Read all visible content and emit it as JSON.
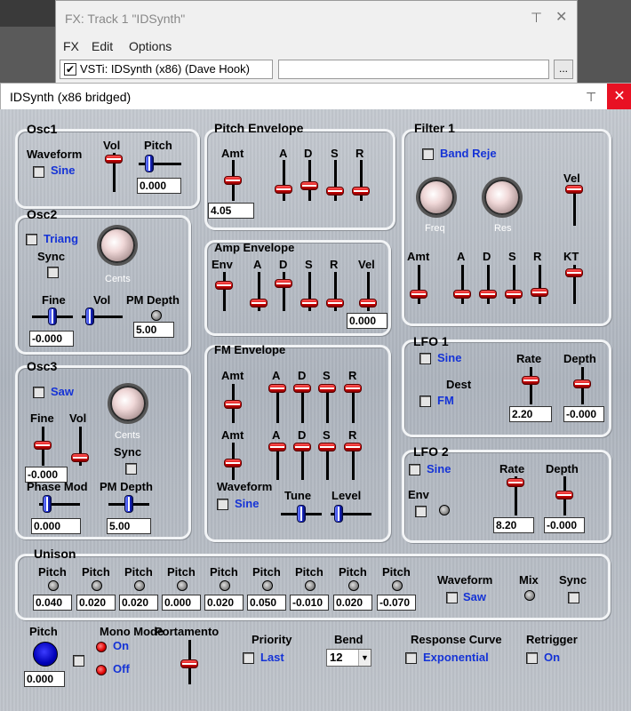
{
  "fx_window": {
    "title": "FX: Track 1 \"IDSynth\"",
    "menu": [
      "FX",
      "Edit",
      "Options"
    ],
    "plugin_checked": "✔",
    "plugin_label": "VSTi: IDSynth (x86) (Dave Hook)",
    "browse": "...",
    "pin": "⊤",
    "close": "✕"
  },
  "window": {
    "title": "IDSynth (x86 bridged)",
    "pin": "⊤",
    "close": "✕"
  },
  "osc1": {
    "title": "Osc1",
    "waveform_label": "Waveform",
    "waveform": "Sine",
    "vol_label": "Vol",
    "pitch_label": "Pitch",
    "pitch_value": "0.000",
    "vol": 0.9,
    "pitch": 0.15
  },
  "osc2": {
    "title": "Osc2",
    "waveform": "Triang",
    "sync_label": "Sync",
    "cents_label": "Cents",
    "fine_label": "Fine",
    "vol_label": "Vol",
    "pm_depth_label": "PM Depth",
    "fine_value": "-0.000",
    "pm_depth_value": "5.00",
    "fine": 0.5,
    "vol": 0.1
  },
  "osc3": {
    "title": "Osc3",
    "waveform": "Saw",
    "cents_label": "Cents",
    "fine_label": "Fine",
    "vol_label": "Vol",
    "sync_label": "Sync",
    "fine_value": "-0.000",
    "phase_mod_label": "Phase Mod",
    "pm_depth_label": "PM Depth",
    "phase_mod_value": "0.000",
    "pm_depth_value": "5.00",
    "fine": 0.5,
    "vol": 0.1,
    "phase_mod": 0.1,
    "pm_depth": 0.5
  },
  "pitch_env": {
    "title": "Pitch Envelope",
    "amt_label": "Amt",
    "a": "A",
    "d": "D",
    "s": "S",
    "r": "R",
    "amt_value": "4.05",
    "amt": 0.4,
    "a_v": 0.2,
    "d_v": 0.3,
    "s_v": 0.0,
    "r_v": 0.0
  },
  "amp_env": {
    "title": "Amp Envelope",
    "env_label": "Env",
    "a": "A",
    "d": "D",
    "s": "S",
    "r": "R",
    "vel_label": "Vel",
    "vel_value": "0.000",
    "env": 0.9,
    "a_v": 0.1,
    "d_v": 0.85,
    "s_v": 0.0,
    "r_v": 0.0,
    "vel": 0.0
  },
  "fm_env": {
    "title": "FM Envelope",
    "amt_label": "Amt",
    "a": "A",
    "d": "D",
    "s": "S",
    "r": "R",
    "amt2_label": "Amt",
    "waveform_label": "Waveform",
    "waveform": "Sine",
    "tune_label": "Tune",
    "level_label": "Level",
    "tune": 0.5,
    "level": 0.1
  },
  "filter1": {
    "title": "Filter 1",
    "type": "Band Reje",
    "freq_label": "Freq",
    "res_label": "Res",
    "vel_label": "Vel",
    "amt_label": "Amt",
    "a": "A",
    "d": "D",
    "s": "S",
    "r": "R",
    "kt_label": "KT"
  },
  "lfo1": {
    "title": "LFO 1",
    "waveform": "Sine",
    "dest_label": "Dest",
    "dest": "FM",
    "rate_label": "Rate",
    "depth_label": "Depth",
    "rate_value": "2.20",
    "depth_value": "-0.000"
  },
  "lfo2": {
    "title": "LFO 2",
    "waveform": "Sine",
    "env_label": "Env",
    "rate_label": "Rate",
    "depth_label": "Depth",
    "rate_value": "8.20",
    "depth_value": "-0.000"
  },
  "unison": {
    "title": "Unison",
    "pitch_label": "Pitch",
    "values": [
      "0.040",
      "0.020",
      "0.020",
      "0.000",
      "0.020",
      "0.050",
      "-0.010",
      "0.020",
      "-0.070"
    ],
    "waveform_label": "Waveform",
    "waveform": "Saw",
    "mix_label": "Mix",
    "sync_label": "Sync"
  },
  "bottom": {
    "pitch_label": "Pitch",
    "pitch_value": "0.000",
    "mono_label": "Mono Mode",
    "on": "On",
    "off": "Off",
    "portamento_label": "Portamento",
    "priority_label": "Priority",
    "priority": "Last",
    "bend_label": "Bend",
    "bend": "12",
    "response_label": "Response Curve",
    "response": "Exponential",
    "retrigger_label": "Retrigger",
    "retrigger": "On"
  },
  "colors": {
    "accent_text": "#1533d6",
    "slider_red": "#d00000",
    "slider_blue": "#1a2ad8",
    "close_red": "#e81123"
  }
}
